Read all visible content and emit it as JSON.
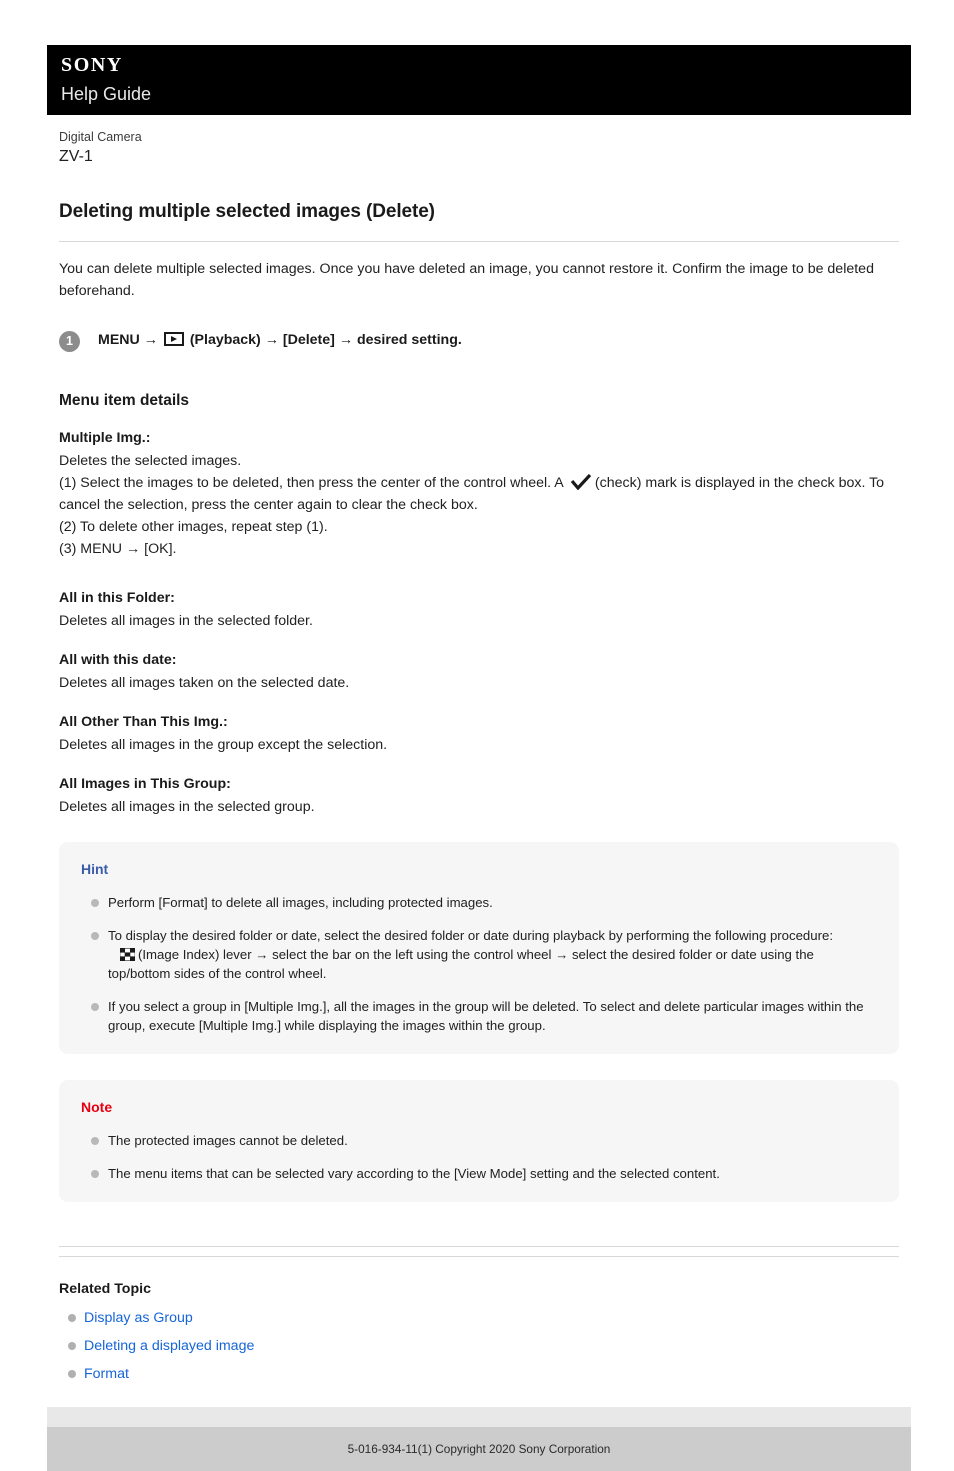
{
  "header": {
    "brand": "SONY",
    "guide_label": "Help Guide"
  },
  "product": {
    "category": "Digital Camera",
    "model": "ZV-1"
  },
  "article": {
    "title": "Deleting multiple selected images (Delete)",
    "intro": "You can delete multiple selected images. Once you have deleted an image, you cannot restore it. Confirm the image to be deleted beforehand.",
    "step": {
      "number": "1",
      "before_icon": "MENU →",
      "icon_name": "playback-icon",
      "after_icon": "(Playback) → [Delete] → desired setting."
    }
  },
  "menu_details": {
    "heading": "Menu item details",
    "items": [
      {
        "term": "Multiple Img.:",
        "desc": "Deletes the selected images.",
        "steps_before_check": "(1) Select the images to be deleted, then press the center of the control wheel. A",
        "check_icon_name": "check-mark-icon",
        "steps_after_check": "(check) mark is displayed in the check box. To cancel the selection, press the center again to clear the check box.",
        "extra_lines": [
          "(2) To delete other images, repeat step (1).",
          "(3) MENU → [OK]."
        ]
      },
      {
        "term": "All in this Folder:",
        "desc": "Deletes all images in the selected folder."
      },
      {
        "term": "All with this date:",
        "desc": "Deletes all images taken on the selected date."
      },
      {
        "term": "All Other Than This Img.:",
        "desc": "Deletes all images in the group except the selection."
      },
      {
        "term": "All Images in This Group:",
        "desc": "Deletes all images in the selected group."
      }
    ]
  },
  "hint": {
    "title": "Hint",
    "title_color": "#3a5caa",
    "bullets": [
      {
        "text": "Perform [Format] to delete all images, including protected images."
      },
      {
        "text": "To display the desired folder or date, select the desired folder or date during playback by performing the following procedure:",
        "icon_name": "image-index-icon",
        "text_after_icon": "(Image Index) lever → select the bar on the left using the control wheel → select the desired folder or date using the",
        "text_tail": "top/bottom sides of the control wheel."
      },
      {
        "text": "If you select a group in [Multiple Img.], all the images in the group will be deleted. To select and delete particular images within the group, execute [Multiple Img.] while displaying the images within the group."
      }
    ]
  },
  "note": {
    "title": "Note",
    "title_color": "#e60012",
    "bullets": [
      {
        "text": "The protected images cannot be deleted."
      },
      {
        "text": "The menu items that can be selected vary according to the [View Mode] setting and the selected content."
      }
    ]
  },
  "related": {
    "title": "Related Topic",
    "links": [
      "Display as Group",
      "Deleting a displayed image",
      "Format"
    ],
    "link_color": "#1665d8"
  },
  "footer": {
    "copyright": "5-016-934-11(1) Copyright 2020 Sony Corporation"
  }
}
